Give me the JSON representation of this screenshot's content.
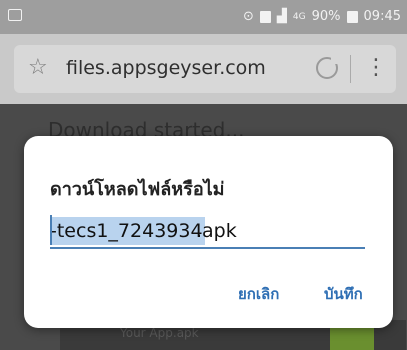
{
  "status": {
    "battery": "90%",
    "time": "09:45",
    "network": "4G"
  },
  "browser": {
    "url": "files.appsgeyser.com"
  },
  "page": {
    "heading": "Download started...",
    "bottom_text": "Your App.apk"
  },
  "dialog": {
    "title": "ดาวน์โหลดไฟล์หรือไม่",
    "filename_selected": "-tecs1_7243934",
    "filename_rest": ".apk",
    "cancel_label": "ยกเลิก",
    "save_label": "บันทึก"
  }
}
